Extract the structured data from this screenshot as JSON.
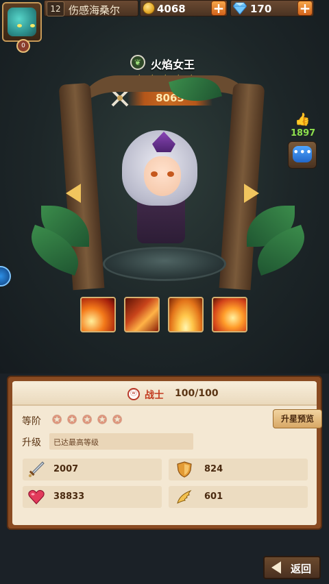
{
  "player": {
    "level": "12",
    "name": "伤感海桑尔",
    "avatar_badge": "0",
    "coins": "4068",
    "gems": "170"
  },
  "hero": {
    "element_icon": "leaf-element-icon",
    "name": "火焰女王",
    "stars": 5,
    "power": "8065",
    "likes": "1897"
  },
  "skills": [
    {
      "icon": "fireball-skill-icon"
    },
    {
      "icon": "fire-dragon-skill-icon"
    },
    {
      "icon": "fire-pillar-skill-icon"
    },
    {
      "icon": "flame-burst-skill-icon"
    }
  ],
  "panel": {
    "class_name": "战士",
    "class_progress": "100/100",
    "rank_label": "等阶",
    "rank_stars": 5,
    "upgrade_preview_label": "升星预览",
    "level_label": "升级",
    "level_status": "已达最高等级",
    "stats": {
      "attack": "2007",
      "defense": "824",
      "hp": "38833",
      "speed": "601"
    }
  },
  "back_label": "返回",
  "colors": {
    "panel_bg": "#f4e8d3",
    "panel_border": "#8a4b22",
    "accent_orange": "#c76a22",
    "star_gold": "#ffd84a"
  }
}
